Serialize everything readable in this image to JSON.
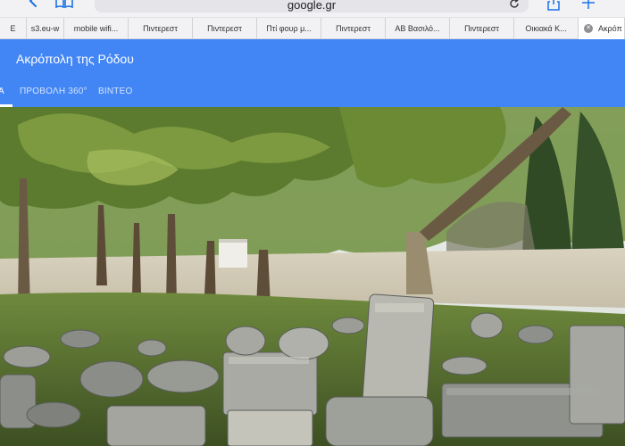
{
  "browser": {
    "url": "google.gr",
    "icons": [
      "back-icon",
      "bookmarks-icon",
      "reload-icon",
      "share-icon",
      "new-tab-icon"
    ]
  },
  "tabs": [
    {
      "label": "Ε"
    },
    {
      "label": "s3.eu-w"
    },
    {
      "label": "mobile wifi..."
    },
    {
      "label": "Πιντερεστ"
    },
    {
      "label": "Πιντερεστ"
    },
    {
      "label": "Πτί φουρ μ..."
    },
    {
      "label": "Πιντερεστ"
    },
    {
      "label": "ΑΒ Βασιλό..."
    },
    {
      "label": "Πιντερεστ"
    },
    {
      "label": "Οικιακά Κ..."
    },
    {
      "label": "Ακρόπ",
      "active": true
    }
  ],
  "place": {
    "title": "Ακρόπολη της Ρόδου",
    "tabs": [
      {
        "label": "Α",
        "selected": true
      },
      {
        "label": "ΠΡΟΒΟΛΗ 360°"
      },
      {
        "label": "ΒΙΝΤΕΟ"
      }
    ]
  },
  "colors": {
    "header_blue": "#4285f4",
    "tab_strip": "#f2f2f4"
  }
}
